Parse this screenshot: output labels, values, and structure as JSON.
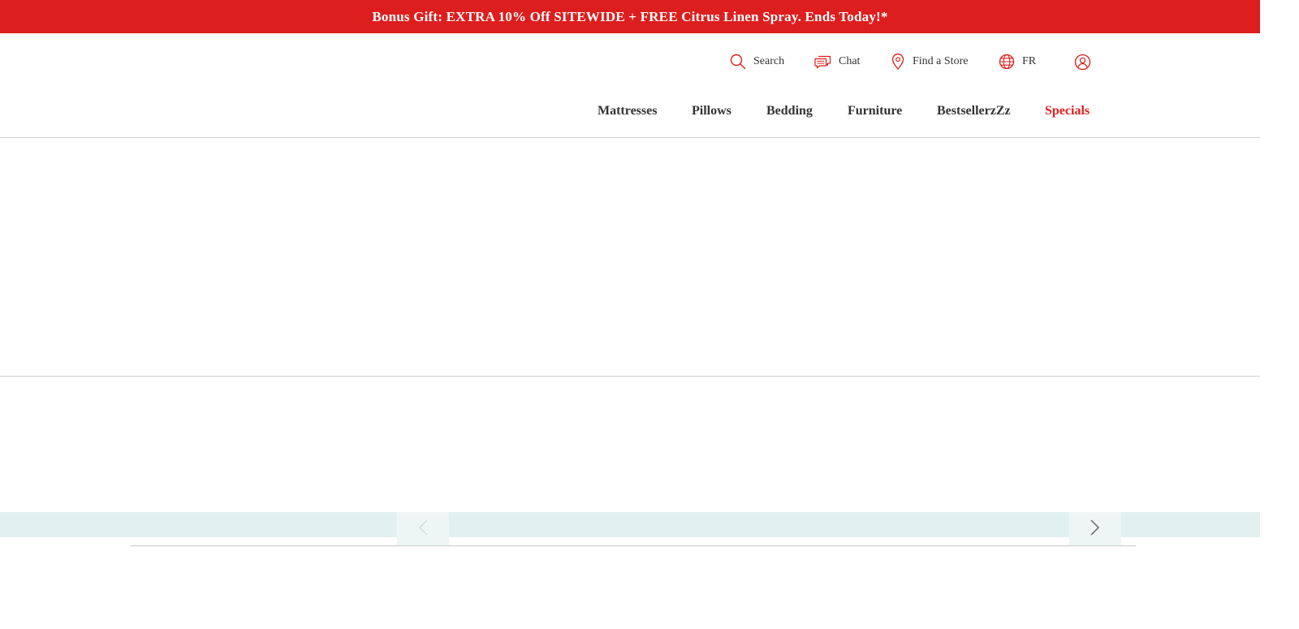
{
  "promo": {
    "text": "Bonus Gift: EXTRA 10% Off SITEWIDE + FREE Citrus Linen Spray. Ends Today!*"
  },
  "utility": {
    "search": {
      "label": "Search",
      "icon": "search-icon"
    },
    "chat": {
      "label": "Chat",
      "icon": "chat-icon"
    },
    "store": {
      "label": "Find a Store",
      "icon": "location-pin-icon"
    },
    "language": {
      "label": "FR",
      "icon": "globe-icon"
    },
    "account": {
      "icon": "user-icon"
    }
  },
  "nav": {
    "items": [
      {
        "label": "Mattresses"
      },
      {
        "label": "Pillows"
      },
      {
        "label": "Bedding"
      },
      {
        "label": "Furniture"
      },
      {
        "label": "BestsellerzZz"
      },
      {
        "label": "Specials"
      }
    ]
  },
  "carousel": {
    "prev_icon": "chevron-left-icon",
    "next_icon": "chevron-right-icon"
  },
  "colors": {
    "brand_red": "#dc1f1e",
    "text": "#333333",
    "carousel_band": "#e2f0f0",
    "divider": "#cfcfcf"
  }
}
